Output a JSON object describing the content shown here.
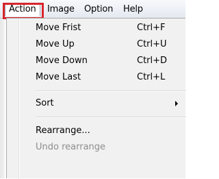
{
  "menubar": {
    "items": [
      {
        "label": "Action"
      },
      {
        "label": "Image"
      },
      {
        "label": "Option"
      },
      {
        "label": "Help"
      }
    ]
  },
  "dropdown": {
    "items": [
      {
        "label": "Move Frist",
        "shortcut": "Ctrl+F",
        "enabled": true
      },
      {
        "label": "Move Up",
        "shortcut": "Ctrl+U",
        "enabled": true
      },
      {
        "label": "Move Down",
        "shortcut": "Ctrl+D",
        "enabled": true
      },
      {
        "label": "Move Last",
        "shortcut": "Ctrl+L",
        "enabled": true
      },
      {
        "label": "Sort",
        "has_submenu": true,
        "enabled": true
      },
      {
        "label": "Rearrange...",
        "enabled": true
      },
      {
        "label": "Undo rearrange",
        "enabled": false
      }
    ]
  },
  "colors": {
    "highlight_border": "#d9252b",
    "menu_background": "#f1f1f1",
    "disabled_text": "#8d8d8d"
  }
}
